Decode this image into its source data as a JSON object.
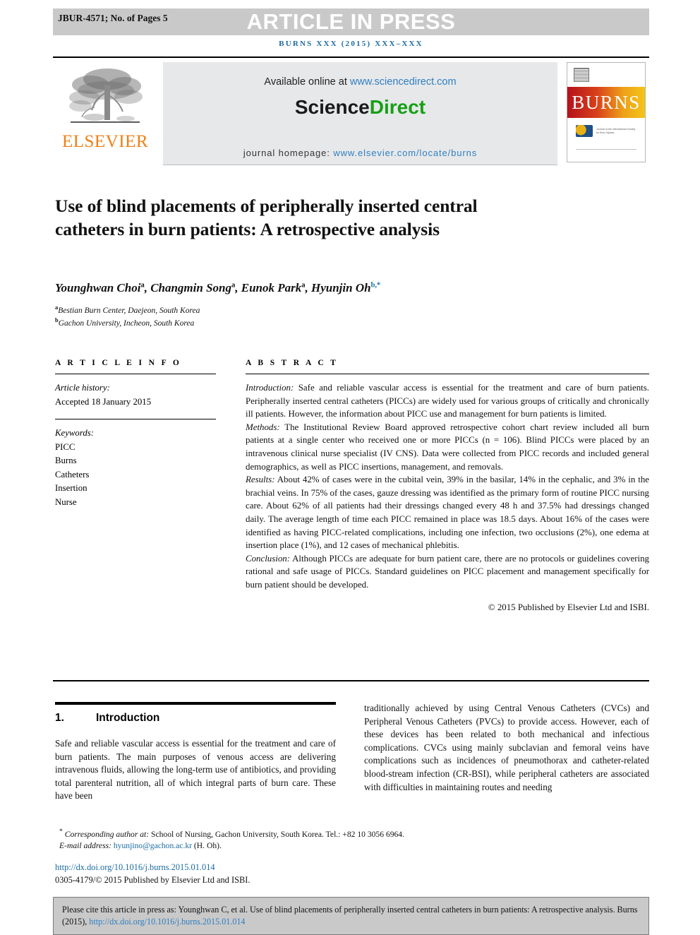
{
  "header": {
    "runhead": "JBUR-4571; No. of Pages 5",
    "banner": "ARTICLE IN PRESS",
    "journal_ref": "burns xxx (2015) xxx–xxx",
    "banner_color": "#c9c9c9",
    "journal_ref_color": "#1a6ba0"
  },
  "masthead": {
    "publisher": "ELSEVIER",
    "publisher_color": "#f07f13",
    "available_prefix": "Available online at ",
    "available_link": "www.sciencedirect.com",
    "sciencedirect_part1": "Science",
    "sciencedirect_part2": "Direct",
    "sciencedirect_color": "#16a016",
    "homepage_label": "journal homepage: ",
    "homepage_link": "www.elsevier.com/locate/burns",
    "cover_title": "BURNS",
    "cover_society": "Journal of the International Society for Burn Injuries"
  },
  "article": {
    "title": "Use of blind placements of peripherally inserted central catheters in burn patients: A retrospective analysis",
    "authors": [
      {
        "name": "Younghwan Choi",
        "sup": "a"
      },
      {
        "name": "Changmin Song",
        "sup": "a"
      },
      {
        "name": "Eunok Park",
        "sup": "a"
      },
      {
        "name": "Hyunjin Oh",
        "sup": "b,*"
      }
    ],
    "affiliations": [
      {
        "marker": "a",
        "text": "Bestian Burn Center, Daejeon, South Korea"
      },
      {
        "marker": "b",
        "text": "Gachon University, Incheon, South Korea"
      }
    ]
  },
  "info": {
    "heading": "A R T I C L E   I N F O",
    "history_label": "Article history:",
    "history_value": "Accepted 18 January 2015",
    "keywords_label": "Keywords:",
    "keywords": [
      "PICC",
      "Burns",
      "Catheters",
      "Insertion",
      "Nurse"
    ]
  },
  "abstract": {
    "heading": "A B S T R A C T",
    "sections": [
      {
        "label": "Introduction:",
        "text": " Safe and reliable vascular access is essential for the treatment and care of burn patients. Peripherally inserted central catheters (PICCs) are widely used for various groups of critically and chronically ill patients. However, the information about PICC use and management for burn patients is limited."
      },
      {
        "label": "Methods:",
        "text": " The Institutional Review Board approved retrospective cohort chart review included all burn patients at a single center who received one or more PICCs (n = 106). Blind PICCs were placed by an intravenous clinical nurse specialist (IV CNS). Data were collected from PICC records and included general demographics, as well as PICC insertions, management, and removals."
      },
      {
        "label": "Results:",
        "text": " About 42% of cases were in the cubital vein, 39% in the basilar, 14% in the cephalic, and 3% in the brachial veins. In 75% of the cases, gauze dressing was identified as the primary form of routine PICC nursing care. About 62% of all patients had their dressings changed every 48 h and 37.5% had dressings changed daily. The average length of time each PICC remained in place was 18.5 days. About 16% of the cases were identified as having PICC-related complications, including one infection, two occlusions (2%), one edema at insertion place (1%), and 12 cases of mechanical phlebitis."
      },
      {
        "label": "Conclusion:",
        "text": " Although PICCs are adequate for burn patient care, there are no protocols or guidelines covering rational and safe usage of PICCs. Standard guidelines on PICC placement and management specifically for burn patient should be developed."
      }
    ],
    "copyright": "© 2015 Published by Elsevier Ltd and ISBI."
  },
  "body": {
    "section_number": "1.",
    "section_title": "Introduction",
    "left_text": "Safe and reliable vascular access is essential for the treatment and care of burn patients. The main purposes of venous access are delivering intravenous fluids, allowing the long-term use of antibiotics, and providing total parenteral nutrition, all of which integral parts of burn care. These have been",
    "right_text": "traditionally achieved by using Central Venous Catheters (CVCs) and Peripheral Venous Catheters (PVCs) to provide access. However, each of these devices has been related to both mechanical and infectious complications. CVCs using mainly subclavian and femoral veins have complications such as incidences of pneumothorax and catheter-related blood-stream infection (CR-BSI), while peripheral catheters are associated with difficulties in maintaining routes and needing"
  },
  "footnotes": {
    "corresponding_marker": "*",
    "corresponding": "Corresponding author at:",
    "corresponding_rest": " School of Nursing, Gachon University, South Korea. Tel.: +82 10 3056 6964.",
    "email_label": "E-mail address:",
    "email": "hyunjino@gachon.ac.kr",
    "email_suffix": " (H. Oh).",
    "doi": "http://dx.doi.org/10.1016/j.burns.2015.01.014",
    "issn_line": "0305-4179/© 2015 Published by Elsevier Ltd and ISBI."
  },
  "cite_box": {
    "text": "Please cite this article in press as: Younghwan C, et al. Use of blind placements of peripherally inserted central catheters in burn patients: A retrospective analysis. Burns (2015), ",
    "link": "http://dx.doi.org/10.1016/j.burns.2015.01.014",
    "background": "#c9c9c9"
  }
}
